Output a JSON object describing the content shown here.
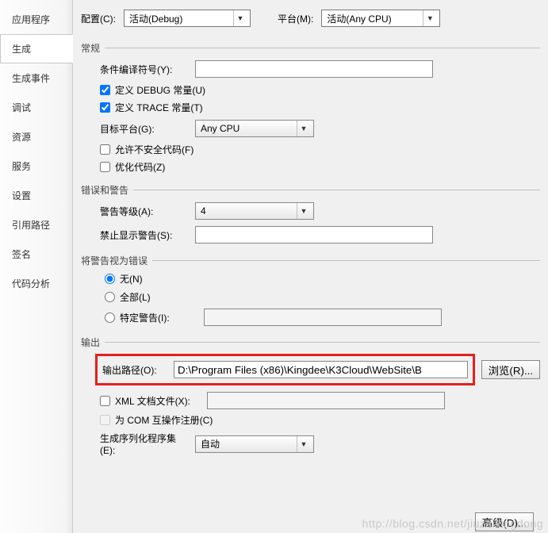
{
  "sidebar": {
    "items": [
      {
        "label": "应用程序"
      },
      {
        "label": "生成"
      },
      {
        "label": "生成事件"
      },
      {
        "label": "调试"
      },
      {
        "label": "资源"
      },
      {
        "label": "服务"
      },
      {
        "label": "设置"
      },
      {
        "label": "引用路径"
      },
      {
        "label": "签名"
      },
      {
        "label": "代码分析"
      }
    ],
    "active_index": 1
  },
  "toprow": {
    "config_label": "配置(C):",
    "config_value": "活动(Debug)",
    "platform_label": "平台(M):",
    "platform_value": "活动(Any CPU)"
  },
  "groups": {
    "general": "常规",
    "errors": "错误和警告",
    "treat_as_error": "将警告视为错误",
    "output": "输出"
  },
  "general": {
    "cond_symbol_label": "条件编译符号(Y):",
    "cond_symbol_value": "",
    "define_debug": "定义 DEBUG 常量(U)",
    "define_trace": "定义 TRACE 常量(T)",
    "target_platform_label": "目标平台(G):",
    "target_platform_value": "Any CPU",
    "allow_unsafe": "允许不安全代码(F)",
    "optimize": "优化代码(Z)"
  },
  "errors": {
    "warn_level_label": "警告等级(A):",
    "warn_level_value": "4",
    "suppress_label": "禁止显示警告(S):",
    "suppress_value": ""
  },
  "treat": {
    "none": "无(N)",
    "all": "全部(L)",
    "specific": "特定警告(I):",
    "specific_value": ""
  },
  "output": {
    "path_label": "输出路径(O):",
    "path_value": "D:\\Program Files (x86)\\Kingdee\\K3Cloud\\WebSite\\B",
    "browse": "浏览(R)...",
    "xml_doc": "XML 文档文件(X):",
    "xml_doc_value": "",
    "com_interop": "为 COM 互操作注册(C)",
    "serialization_label": "生成序列化程序集(E):",
    "serialization_value": "自动",
    "advanced": "高级(D)..."
  },
  "watermark": "http://blog.csdn.net/jiuzaixingdong"
}
